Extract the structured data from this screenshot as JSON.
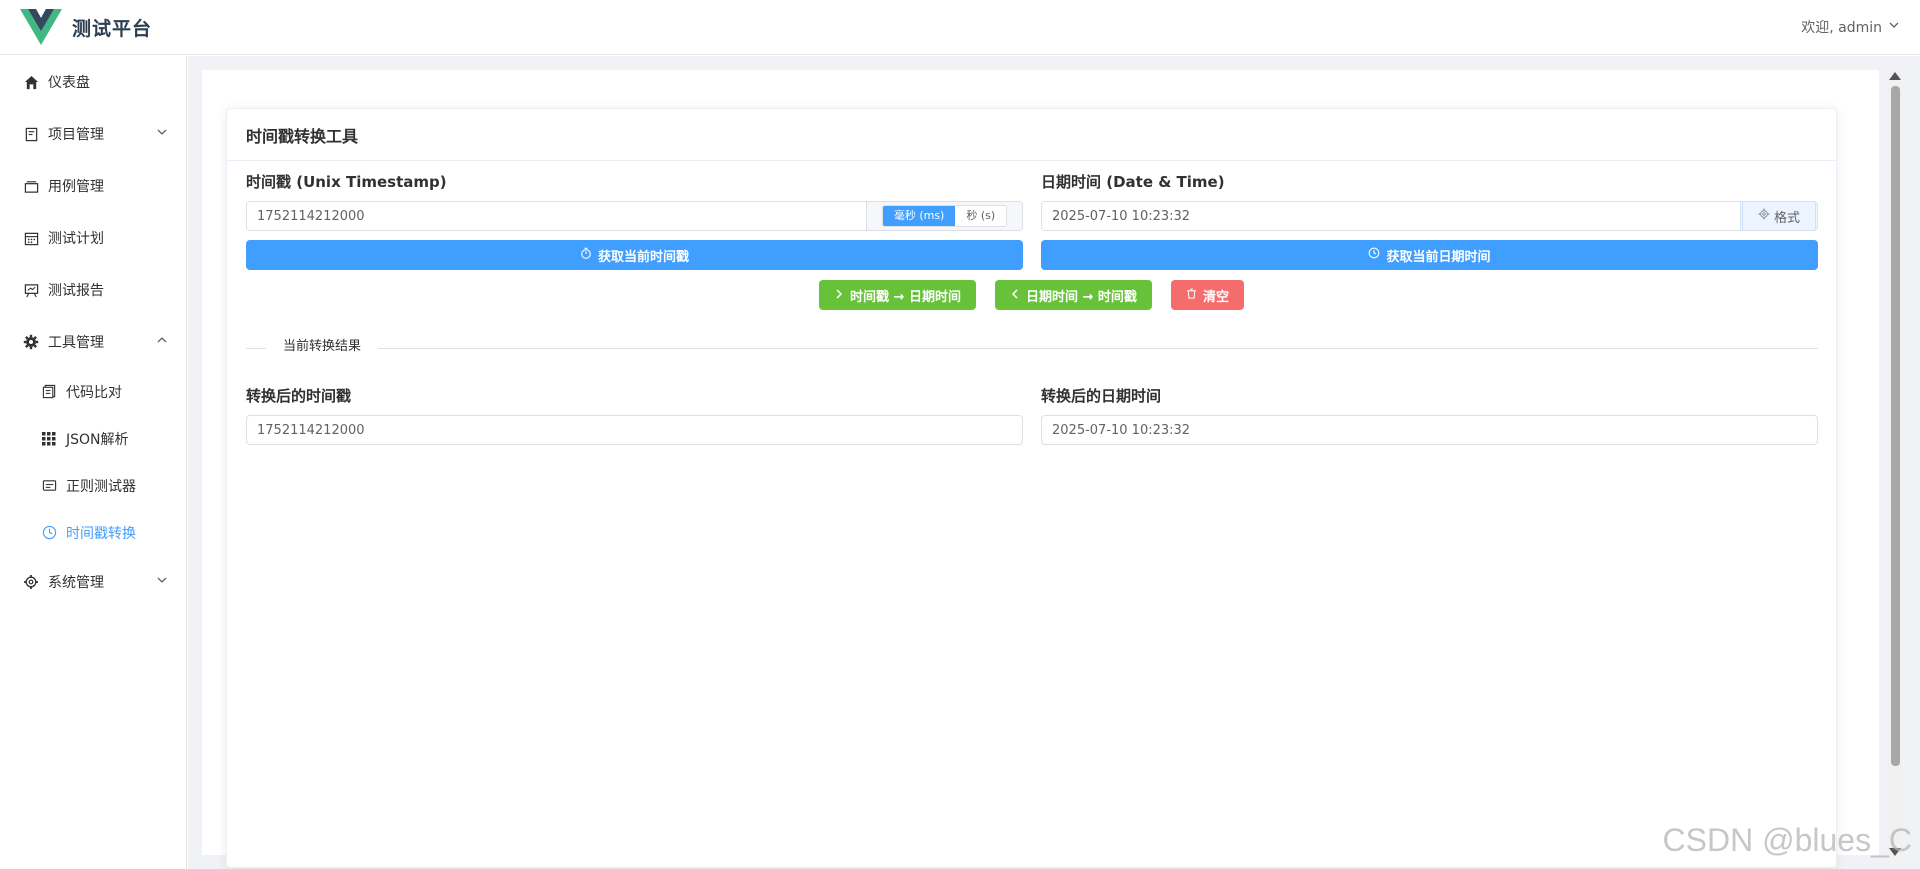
{
  "header": {
    "brand_title": "测试平台",
    "user_greeting": "欢迎, admin"
  },
  "sidebar": {
    "items": [
      {
        "label": "仪表盘",
        "icon": "home-icon"
      },
      {
        "label": "项目管理",
        "icon": "project-icon"
      },
      {
        "label": "用例管理",
        "icon": "cases-icon"
      },
      {
        "label": "测试计划",
        "icon": "calendar-icon"
      },
      {
        "label": "测试报告",
        "icon": "report-icon"
      },
      {
        "label": "工具管理",
        "icon": "gear-icon"
      },
      {
        "label": "系统管理",
        "icon": "settings-icon"
      }
    ],
    "tool_sub_items": [
      {
        "label": "代码比对",
        "icon": "compare-icon"
      },
      {
        "label": "JSON解析",
        "icon": "grid-icon"
      },
      {
        "label": "正则测试器",
        "icon": "regex-icon"
      },
      {
        "label": "时间戳转换",
        "icon": "clock-icon",
        "active": true
      }
    ]
  },
  "card": {
    "title": "时间戳转换工具",
    "timestamp": {
      "label": "时间戳 (Unix Timestamp)",
      "value": "1752114212000",
      "unit_ms": "毫秒 (ms)",
      "unit_s": "秒 (s)",
      "selected_unit": "ms",
      "get_now_button": "获取当前时间戳"
    },
    "datetime": {
      "label": "日期时间 (Date & Time)",
      "value": "2025-07-10 10:23:32",
      "format_button": "格式",
      "get_now_button": "获取当前日期时间"
    },
    "actions": {
      "to_datetime": "时间戳 → 日期时间",
      "to_timestamp": "日期时间 → 时间戳",
      "clear": "清空"
    },
    "result": {
      "section_title": "当前转换结果",
      "timestamp_label": "转换后的时间戳",
      "timestamp_value": "1752114212000",
      "datetime_label": "转换后的日期时间",
      "datetime_value": "2025-07-10 10:23:32"
    }
  },
  "watermark": "CSDN @blues_C",
  "colors": {
    "primary": "#409eff",
    "success": "#67c23a",
    "danger": "#f56c6c",
    "logo_green": "#41b883",
    "logo_dark": "#35495e"
  }
}
